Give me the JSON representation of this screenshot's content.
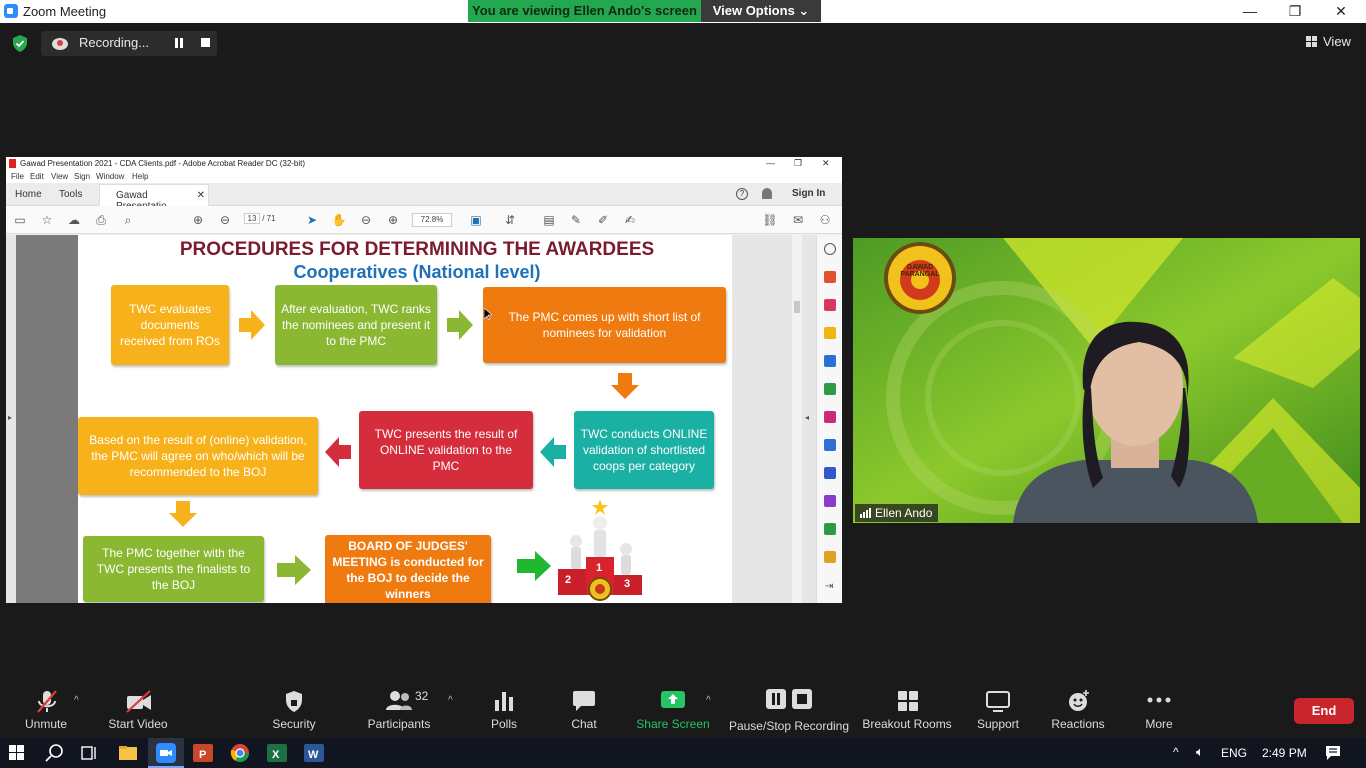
{
  "window": {
    "title": "Zoom Meeting",
    "minimize": "—",
    "maximize": "❐",
    "close": "✕"
  },
  "share_banner": {
    "viewing_text": "You are viewing Ellen Ando's screen",
    "view_options": "View Options ⌄"
  },
  "status": {
    "recording_label": "Recording...",
    "view_label": "View"
  },
  "acrobat": {
    "title": "Gawad Presentation 2021 - CDA Clients.pdf - Adobe Acrobat Reader DC (32-bit)",
    "menu": [
      "File",
      "Edit",
      "View",
      "Sign",
      "Window",
      "Help"
    ],
    "tabs": {
      "home": "Home",
      "tools": "Tools",
      "doc": "Gawad Presentatio...",
      "doc_close": "✕",
      "help": "?",
      "sign_in": "Sign In"
    },
    "page_current": "13",
    "page_total": "/ 71",
    "zoom": "72.8%"
  },
  "slide": {
    "title": "PROCEDURES FOR DETERMINING THE AWARDEES",
    "subtitle": "Cooperatives (National level)",
    "boxes": {
      "b1": "TWC evaluates documents received from ROs",
      "b2": "After evaluation, TWC ranks the nominees and present it to the PMC",
      "b3": "The PMC comes up with short list of nominees for validation",
      "b4": "TWC conducts ONLINE validation of shortlisted coops per category",
      "b5": "TWC presents the result of ONLINE validation to the PMC",
      "b6": "Based on the result of (online) validation, the PMC will agree on who/which will be recommended to the BOJ",
      "b7": "The PMC together with the TWC presents  the finalists to the BOJ",
      "b8": "BOARD OF JUDGES' MEETING is conducted for the BOJ to decide the winners"
    },
    "podium": [
      "2",
      "1",
      "3"
    ],
    "colors": {
      "orange": "#f7b21b",
      "green": "#8ab833",
      "deep_orange": "#ef7b10",
      "teal": "#1bb0a4",
      "red": "#d52d3c",
      "title_red": "#7b1c2e",
      "title_blue": "#1f72b8"
    }
  },
  "video": {
    "participant_name": "Ellen Ando",
    "logo_text": "GAWAD PARANGAL"
  },
  "toolbar": {
    "unmute": "Unmute",
    "start_video": "Start Video",
    "security": "Security",
    "participants": "Participants",
    "participants_count": "32",
    "polls": "Polls",
    "chat": "Chat",
    "share_screen": "Share Screen",
    "pause_stop_recording": "Pause/Stop Recording",
    "breakout_rooms": "Breakout Rooms",
    "support": "Support",
    "reactions": "Reactions",
    "more": "More",
    "end": "End"
  },
  "taskbar": {
    "language": "ENG",
    "time": "2:49 PM",
    "apps": [
      "start-icon",
      "search-icon",
      "task-view-icon",
      "file-explorer-icon",
      "zoom-app-icon",
      "powerpoint-icon",
      "chrome-icon",
      "excel-icon",
      "word-icon"
    ]
  }
}
